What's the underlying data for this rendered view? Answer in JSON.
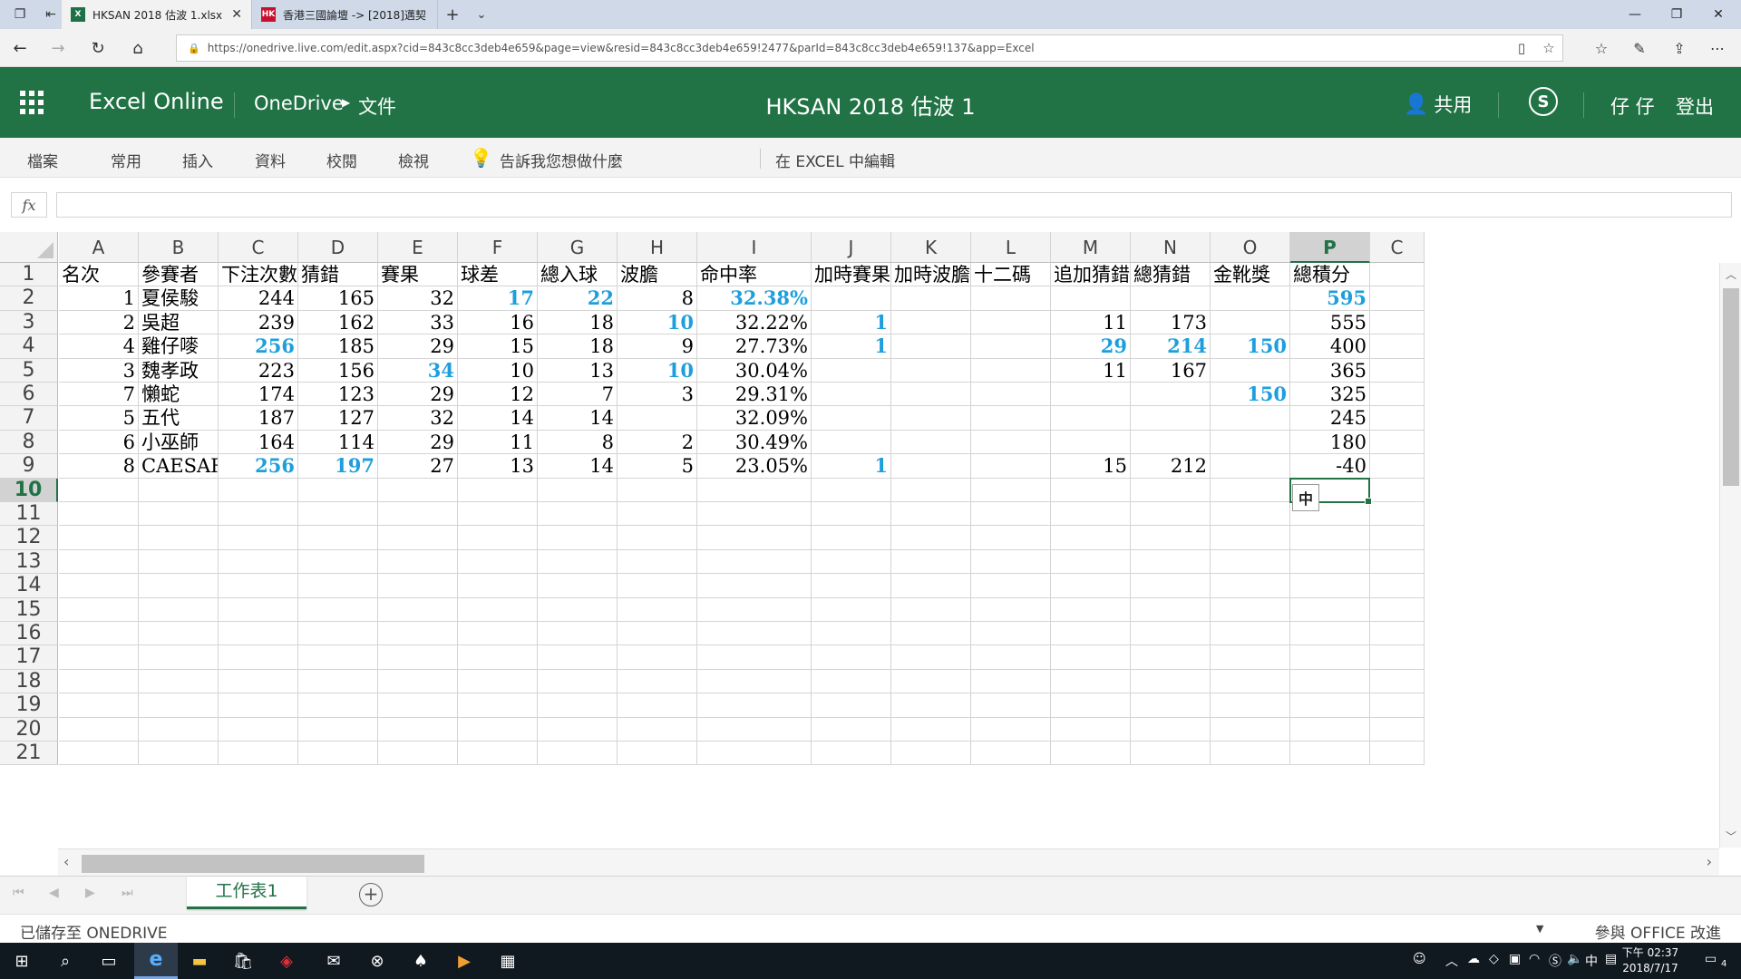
{
  "browser": {
    "tabs": [
      {
        "title": "HKSAN 2018 估波 1.xlsx",
        "favicon": "X"
      },
      {
        "title": "香港三國論壇 -> [2018]邁契",
        "favicon": "HK"
      }
    ],
    "url": "https://onedrive.live.com/edit.aspx?cid=843c8cc3deb4e659&page=view&resid=843c8cc3deb4e659!2477&parId=843c8cc3deb4e659!137&app=Excel"
  },
  "header": {
    "app_name": "Excel Online",
    "breadcrumb": [
      "OneDrive",
      "文件"
    ],
    "doc_title": "HKSAN 2018 估波 1",
    "share_label": "共用",
    "user_name": "仔 仔",
    "signout_label": "登出",
    "brand_color": "#217346"
  },
  "ribbon": {
    "items": [
      "檔案",
      "常用",
      "插入",
      "資料",
      "校閱",
      "檢視"
    ],
    "tell_me": "告訴我您想做什麼",
    "edit_in_excel": "在 EXCEL 中編輯"
  },
  "formula_bar": {
    "fx_label": "fx",
    "value": ""
  },
  "grid": {
    "columns": [
      "A",
      "B",
      "C",
      "D",
      "E",
      "F",
      "G",
      "H",
      "I",
      "J",
      "K",
      "L",
      "M",
      "N",
      "O",
      "P",
      "C"
    ],
    "selected_column": "P",
    "rows": [
      "1",
      "2",
      "3",
      "4",
      "5",
      "6",
      "7",
      "8",
      "9",
      "10",
      "11",
      "12",
      "13",
      "14",
      "15",
      "16",
      "17",
      "18",
      "19",
      "20",
      "21"
    ],
    "selected_row": "10",
    "highlight_color": "#1e9fdc",
    "header_row": [
      "名次",
      "參賽者",
      "下注次數",
      "猜錯",
      "賽果",
      "球差",
      "總入球",
      "波膽",
      "命中率",
      "加時賽果",
      "加時波膽",
      "十二碼",
      "追加猜錯",
      "總猜錯",
      "金靴獎",
      "總積分"
    ],
    "data": [
      [
        "1",
        "夏侯駿",
        "244",
        "165",
        "32",
        "17",
        "22",
        "8",
        "32.38%",
        "",
        "",
        "",
        "",
        "",
        "",
        "595"
      ],
      [
        "2",
        "吳超",
        "239",
        "162",
        "33",
        "16",
        "18",
        "10",
        "32.22%",
        "1",
        "",
        "",
        "11",
        "173",
        "",
        "555"
      ],
      [
        "4",
        "雞仔嘜",
        "256",
        "185",
        "29",
        "15",
        "18",
        "9",
        "27.73%",
        "1",
        "",
        "",
        "29",
        "214",
        "150",
        "400"
      ],
      [
        "3",
        "魏孝政",
        "223",
        "156",
        "34",
        "10",
        "13",
        "10",
        "30.04%",
        "",
        "",
        "",
        "11",
        "167",
        "",
        "365"
      ],
      [
        "7",
        "懶蛇",
        "174",
        "123",
        "29",
        "12",
        "7",
        "3",
        "29.31%",
        "",
        "",
        "",
        "",
        "",
        "150",
        "325"
      ],
      [
        "5",
        "五代",
        "187",
        "127",
        "32",
        "14",
        "14",
        "",
        "32.09%",
        "",
        "",
        "",
        "",
        "",
        "",
        "245"
      ],
      [
        "6",
        "小巫師",
        "164",
        "114",
        "29",
        "11",
        "8",
        "2",
        "30.49%",
        "",
        "",
        "",
        "",
        "",
        "",
        "180"
      ],
      [
        "8",
        "CAESAR",
        "256",
        "197",
        "27",
        "13",
        "14",
        "5",
        "23.05%",
        "1",
        "",
        "",
        "15",
        "212",
        "",
        "-40"
      ]
    ],
    "highlights": [
      [
        false,
        false,
        false,
        false,
        false,
        true,
        true,
        false,
        true,
        false,
        false,
        false,
        false,
        false,
        false,
        true
      ],
      [
        false,
        false,
        false,
        false,
        false,
        false,
        false,
        true,
        false,
        true,
        false,
        false,
        false,
        false,
        false,
        false
      ],
      [
        false,
        false,
        true,
        false,
        false,
        false,
        false,
        false,
        false,
        true,
        false,
        false,
        true,
        true,
        true,
        false
      ],
      [
        false,
        false,
        false,
        false,
        true,
        false,
        false,
        true,
        false,
        false,
        false,
        false,
        false,
        false,
        false,
        false
      ],
      [
        false,
        false,
        false,
        false,
        false,
        false,
        false,
        false,
        false,
        false,
        false,
        false,
        false,
        false,
        true,
        false
      ],
      [
        false,
        false,
        false,
        false,
        false,
        false,
        false,
        false,
        false,
        false,
        false,
        false,
        false,
        false,
        false,
        false
      ],
      [
        false,
        false,
        false,
        false,
        false,
        false,
        false,
        false,
        false,
        false,
        false,
        false,
        false,
        false,
        false,
        false
      ],
      [
        false,
        false,
        true,
        true,
        false,
        false,
        false,
        false,
        false,
        true,
        false,
        false,
        false,
        false,
        false,
        false
      ]
    ],
    "ime_badge": "中"
  },
  "sheets": {
    "active": "工作表1"
  },
  "status": {
    "saved": "已儲存至 ONEDRIVE",
    "feedback": "參與 OFFICE 改進"
  },
  "taskbar": {
    "clock_time": "下午 02:37",
    "clock_date": "2018/7/17",
    "ime": "中",
    "notification_count": "4"
  }
}
